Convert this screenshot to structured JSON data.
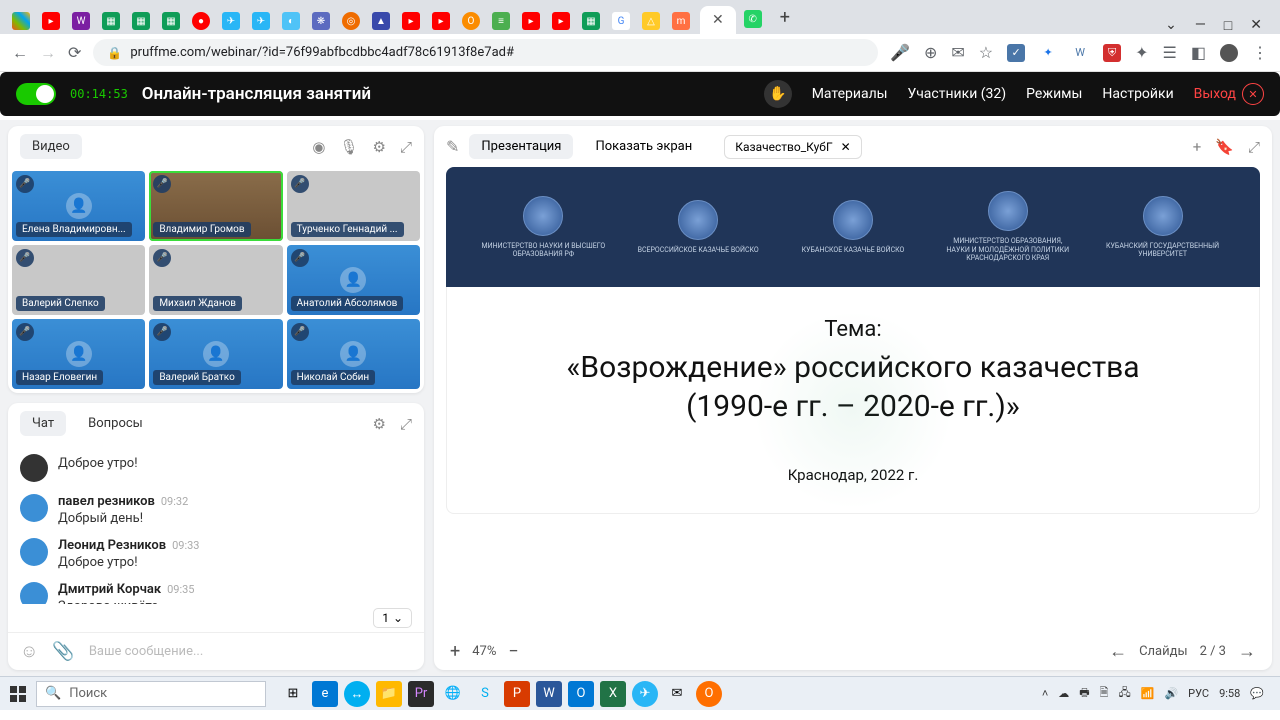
{
  "browser": {
    "url": "pruffme.com/webinar/?id=76f99abfbcdbbc4adf78c61913f8e7ad#",
    "window_controls": {
      "min": "—",
      "max": "□",
      "close": "✕"
    },
    "tab_new": "+",
    "tab_menu": "⌄"
  },
  "app_bar": {
    "timer": "00:14:53",
    "title": "Онлайн-трансляция занятий",
    "menu": {
      "materials": "Материалы",
      "participants": "Участники (32)",
      "modes": "Режимы",
      "settings": "Настройки",
      "exit": "Выход"
    }
  },
  "video": {
    "tab_label": "Видео",
    "tiles": [
      {
        "name": "Елена Владимировн...",
        "type": "blue"
      },
      {
        "name": "Владимир Громов",
        "type": "room",
        "active": true
      },
      {
        "name": "Турченко Геннадий ...",
        "type": "grey"
      },
      {
        "name": "Валерий Слепко",
        "type": "grey"
      },
      {
        "name": "Михаил Жданов",
        "type": "grey"
      },
      {
        "name": "Анатолий Абсолямов",
        "type": "blue"
      },
      {
        "name": "Назар Еловегин",
        "type": "blue"
      },
      {
        "name": "Валерий Братко",
        "type": "blue"
      },
      {
        "name": "Николай Собин",
        "type": "blue"
      }
    ]
  },
  "chat": {
    "tab_chat": "Чат",
    "tab_questions": "Вопросы",
    "page": "1",
    "messages": [
      {
        "name": "",
        "time": "",
        "text": "Доброе утро!",
        "avatar_dark": true
      },
      {
        "name": "павел резников",
        "time": "09:32",
        "text": "Добрый день!"
      },
      {
        "name": "Леонид Резников",
        "time": "09:33",
        "text": "Доброе утро!"
      },
      {
        "name": "Дмитрий Корчак",
        "time": "09:35",
        "text": "Здорово живёте."
      }
    ],
    "input_placeholder": "Ваше сообщение..."
  },
  "presentation": {
    "tab_present": "Презентация",
    "tab_screen": "Показать экран",
    "file_name": "Казачество_КубГ",
    "banner_orgs": [
      "МИНИСТЕРСТВО НАУКИ И ВЫСШЕГО ОБРАЗОВАНИЯ РФ",
      "ВСЕРОССИЙСКОЕ КАЗАЧЬЕ ВОЙСКО",
      "КУБАНСКОЕ КАЗАЧЬЕ ВОЙСКО",
      "МИНИСТЕРСТВО ОБРАЗОВАНИЯ, НАУКИ И МОЛОДЁЖНОЙ ПОЛИТИКИ КРАСНОДАРСКОГО КРАЯ",
      "КУБАНСКИЙ ГОСУДАРСТВЕННЫЙ УНИВЕРСИТЕТ"
    ],
    "theme_label": "Тема:",
    "title_line1": "«Возрождение» российского казачества",
    "title_line2": "(1990-е гг. – 2020-е гг.)»",
    "place": "Краснодар, 2022 г.",
    "zoom": "47%",
    "slides_label": "Слайды",
    "slides_pos": "2 / 3"
  },
  "taskbar": {
    "search_placeholder": "Поиск",
    "lang": "РУС",
    "time": "9:58"
  }
}
